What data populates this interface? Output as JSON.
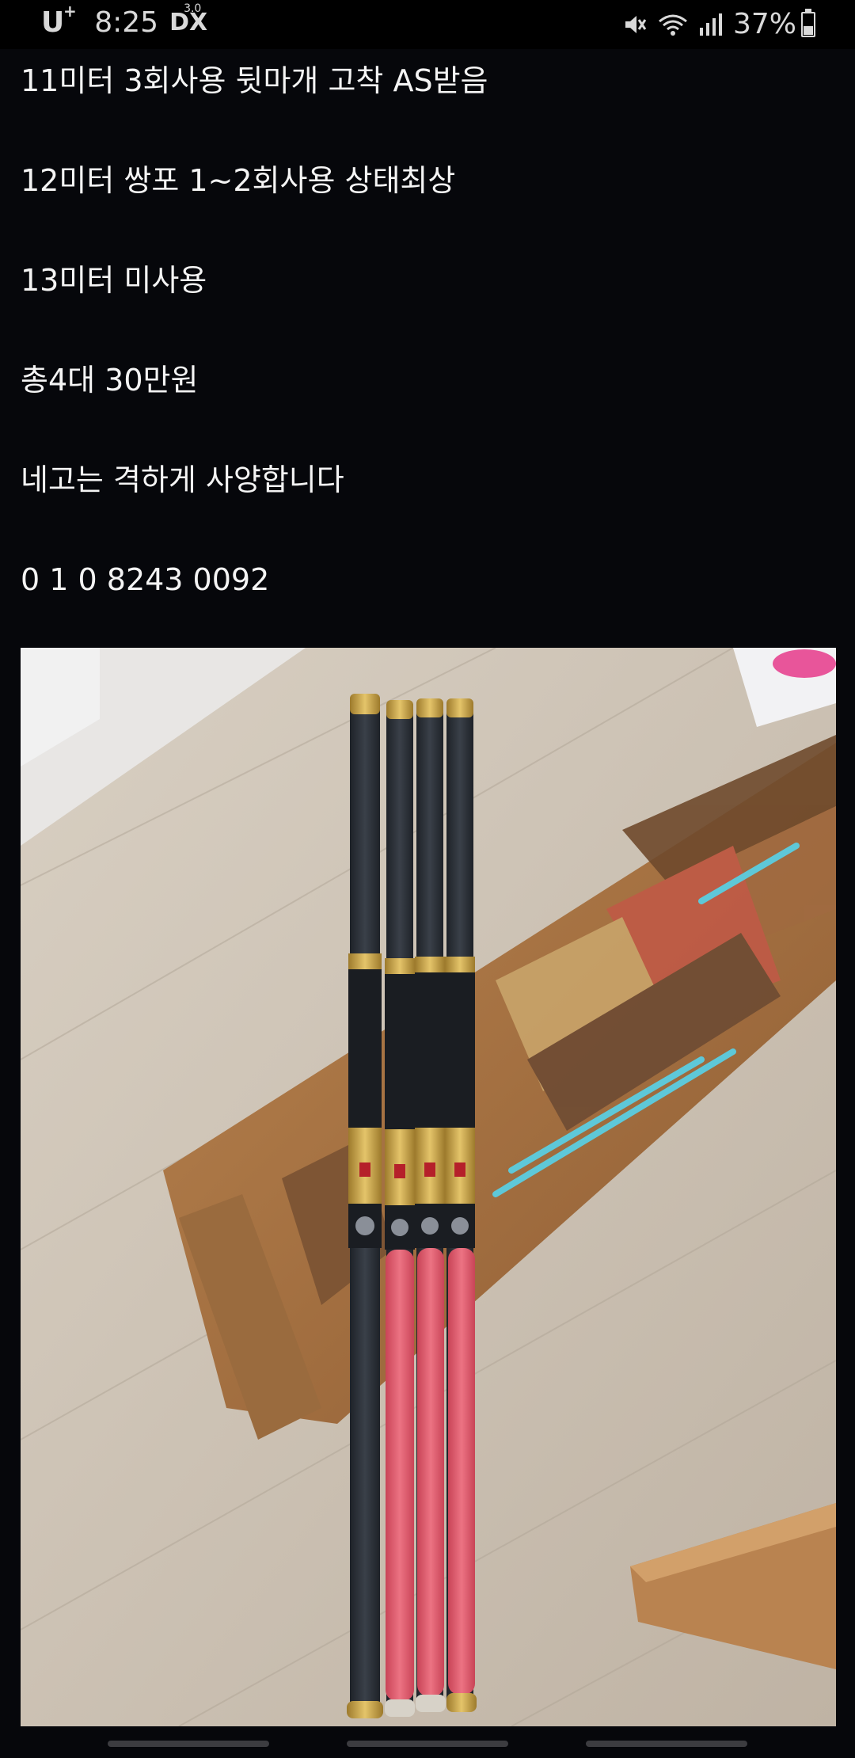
{
  "status_bar": {
    "carrier": "U",
    "carrier_sup": "+",
    "time": "8:25",
    "network": "DX",
    "network_sup": "3.0",
    "battery": "37%",
    "battery_level": 0.37
  },
  "post": {
    "lines": [
      "11미터 3회사용 뒷마개 고착 AS받음",
      "12미터 쌍포 1~2회사용 상태최상",
      "13미터 미사용",
      "총4대 30만원",
      "네고는 격하게 사양합니다",
      "0 1 0 8243 0092"
    ]
  },
  "photo": {
    "icon": "fishing-rods-photo"
  },
  "colors": {
    "background": "#06070b",
    "text": "#f4f4f4",
    "rod_dark": "#2b3037",
    "rod_gold": "#c9a54a",
    "rod_grip_red": "#e05a6a"
  }
}
